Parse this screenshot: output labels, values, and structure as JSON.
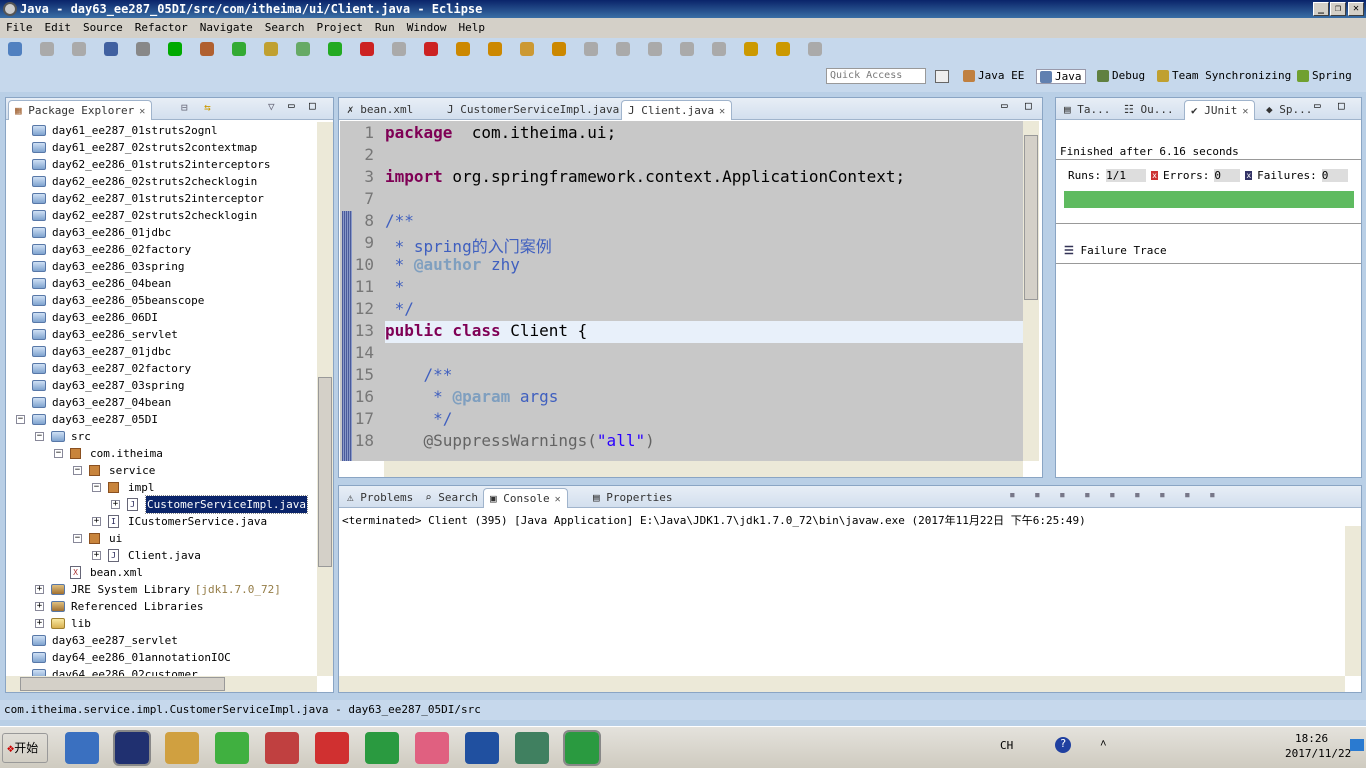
{
  "window": {
    "title": "Java - day63_ee287_05DI/src/com/itheima/ui/Client.java - Eclipse",
    "buttons": [
      "_",
      "❐",
      "✕"
    ]
  },
  "menu": [
    "File",
    "Edit",
    "Source",
    "Refactor",
    "Navigate",
    "Search",
    "Project",
    "Run",
    "Window",
    "Help"
  ],
  "quick_access": {
    "placeholder": "Quick Access"
  },
  "perspectives": [
    {
      "label": "Java EE",
      "color": "#c08040"
    },
    {
      "label": "Java",
      "color": "#6080b0"
    },
    {
      "label": "Debug",
      "color": "#608040"
    },
    {
      "label": "Team Synchronizing",
      "color": "#c0a030"
    },
    {
      "label": "Spring",
      "color": "#70a030"
    }
  ],
  "package_explorer": {
    "title": "Package Explorer",
    "items": [
      {
        "label": "day61_ee287_01struts2ognl",
        "level": 0,
        "type": "project"
      },
      {
        "label": "day61_ee287_02struts2contextmap",
        "level": 0,
        "type": "project"
      },
      {
        "label": "day62_ee286_01struts2interceptors",
        "level": 0,
        "type": "project"
      },
      {
        "label": "day62_ee286_02struts2checklogin",
        "level": 0,
        "type": "project"
      },
      {
        "label": "day62_ee287_01struts2interceptor",
        "level": 0,
        "type": "project"
      },
      {
        "label": "day62_ee287_02struts2checklogin",
        "level": 0,
        "type": "project"
      },
      {
        "label": "day63_ee286_01jdbc",
        "level": 0,
        "type": "project"
      },
      {
        "label": "day63_ee286_02factory",
        "level": 0,
        "type": "project"
      },
      {
        "label": "day63_ee286_03spring",
        "level": 0,
        "type": "project"
      },
      {
        "label": "day63_ee286_04bean",
        "level": 0,
        "type": "project"
      },
      {
        "label": "day63_ee286_05beanscope",
        "level": 0,
        "type": "project"
      },
      {
        "label": "day63_ee286_06DI",
        "level": 0,
        "type": "project"
      },
      {
        "label": "day63_ee286_servlet",
        "level": 0,
        "type": "project"
      },
      {
        "label": "day63_ee287_01jdbc",
        "level": 0,
        "type": "project"
      },
      {
        "label": "day63_ee287_02factory",
        "level": 0,
        "type": "project"
      },
      {
        "label": "day63_ee287_03spring",
        "level": 0,
        "type": "project"
      },
      {
        "label": "day63_ee287_04bean",
        "level": 0,
        "type": "project"
      },
      {
        "label": "day63_ee287_05DI",
        "level": 0,
        "type": "project",
        "expanded": true
      },
      {
        "label": "src",
        "level": 1,
        "type": "srcfolder",
        "expanded": true
      },
      {
        "label": "com.itheima",
        "level": 2,
        "type": "package",
        "expanded": true
      },
      {
        "label": "service",
        "level": 3,
        "type": "package",
        "expanded": true
      },
      {
        "label": "impl",
        "level": 4,
        "type": "package",
        "expanded": true
      },
      {
        "label": "CustomerServiceImpl.java",
        "level": 5,
        "type": "java",
        "selected": true,
        "collapsed": true
      },
      {
        "label": "ICustomerService.java",
        "level": 4,
        "type": "java",
        "collapsed": true
      },
      {
        "label": "ui",
        "level": 3,
        "type": "package",
        "expanded": true
      },
      {
        "label": "Client.java",
        "level": 4,
        "type": "java",
        "collapsed": true
      },
      {
        "label": "bean.xml",
        "level": 2,
        "type": "xml"
      },
      {
        "label": "JRE System Library",
        "suffix": "[jdk1.7.0_72]",
        "level": 1,
        "type": "library",
        "collapsed": true
      },
      {
        "label": "Referenced Libraries",
        "level": 1,
        "type": "library",
        "collapsed": true
      },
      {
        "label": "lib",
        "level": 1,
        "type": "folder",
        "collapsed": true
      },
      {
        "label": "day63_ee287_servlet",
        "level": 0,
        "type": "project"
      },
      {
        "label": "day64_ee286_01annotationIOC",
        "level": 0,
        "type": "project"
      },
      {
        "label": "day64_ee286_02customer",
        "level": 0,
        "type": "project"
      }
    ]
  },
  "editor": {
    "tabs": [
      {
        "label": "bean.xml"
      },
      {
        "label": "CustomerServiceImpl.java"
      },
      {
        "label": "Client.java",
        "active": true
      }
    ],
    "lines": [
      {
        "n": "1",
        "parts": [
          [
            "kw",
            "package"
          ],
          [
            "",
            "  com.itheima.ui;"
          ]
        ]
      },
      {
        "n": "2",
        "parts": []
      },
      {
        "n": "3",
        "parts": [
          [
            "kw",
            "import"
          ],
          [
            "",
            " org.springframework.context.ApplicationContext;"
          ]
        ]
      },
      {
        "n": "7",
        "parts": []
      },
      {
        "n": "8",
        "parts": [
          [
            "cm",
            "/**"
          ]
        ]
      },
      {
        "n": "9",
        "parts": [
          [
            "cm",
            " * spring的入门案例"
          ]
        ]
      },
      {
        "n": "10",
        "parts": [
          [
            "cm",
            " * "
          ],
          [
            "tg",
            "@author"
          ],
          [
            "cm",
            " zhy"
          ]
        ]
      },
      {
        "n": "11",
        "parts": [
          [
            "cm",
            " *"
          ]
        ]
      },
      {
        "n": "12",
        "parts": [
          [
            "cm",
            " */"
          ]
        ]
      },
      {
        "n": "13",
        "parts": [
          [
            "kw",
            "public class"
          ],
          [
            "",
            " Client {"
          ]
        ]
      },
      {
        "n": "14",
        "parts": []
      },
      {
        "n": "15",
        "parts": [
          [
            "cm",
            "    /**"
          ]
        ]
      },
      {
        "n": "16",
        "parts": [
          [
            "cm",
            "     * "
          ],
          [
            "tg",
            "@param"
          ],
          [
            "cm",
            " args"
          ]
        ]
      },
      {
        "n": "17",
        "parts": [
          [
            "cm",
            "     */"
          ]
        ]
      },
      {
        "n": "18",
        "parts": [
          [
            "an",
            "    @SuppressWarnings("
          ],
          [
            "st",
            "\"all\""
          ],
          [
            "an",
            ")"
          ]
        ]
      }
    ]
  },
  "junit": {
    "tabs": [
      "Ta...",
      "Ou...",
      "JUnit",
      "Sp..."
    ],
    "status": "Finished after 6.16 seconds",
    "runs_label": "Runs:",
    "runs": "1/1",
    "errors_label": "Errors:",
    "errors": "0",
    "failures_label": "Failures:",
    "failures": "0",
    "progress": 1.0,
    "bar_color": "#5fbb60",
    "failure_trace": "Failure Trace"
  },
  "console": {
    "tabs": [
      "Problems",
      "Search",
      "Console",
      "Properties"
    ],
    "active": "Console",
    "text": "<terminated> Client (395) [Java Application] E:\\Java\\JDK1.7\\jdk1.7.0_72\\bin\\javaw.exe (2017年11月22日 下午6:25:49)"
  },
  "status_bar": {
    "text": "com.itheima.service.impl.CustomerServiceImpl.java - day63_ee287_05DI/src"
  },
  "taskbar": {
    "start": "开始",
    "lang": "CH",
    "time": "18:26",
    "date": "2017/11/22"
  }
}
